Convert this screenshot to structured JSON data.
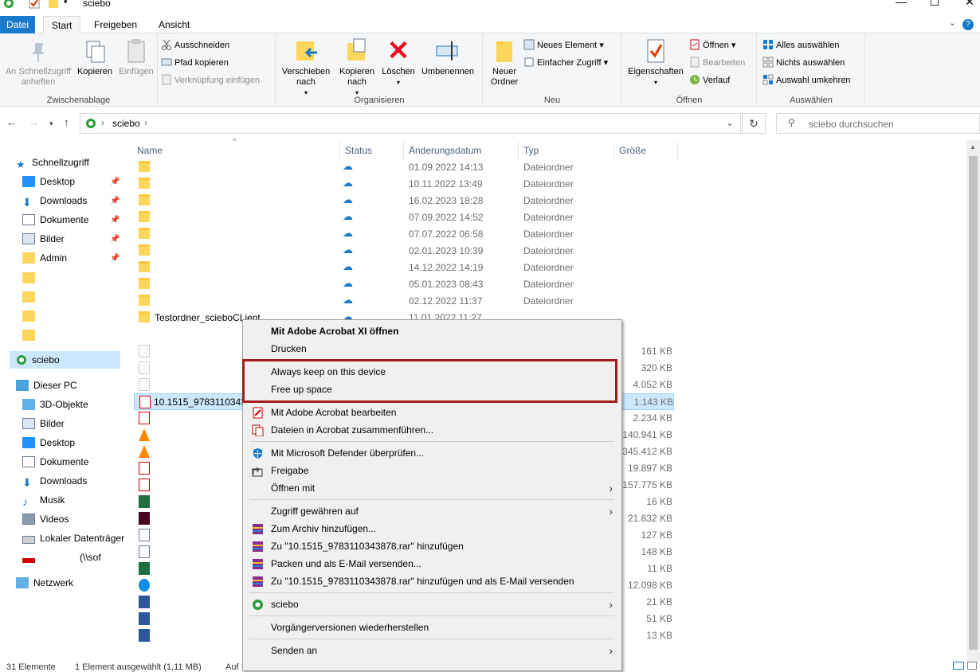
{
  "window": {
    "title": "sciebo",
    "min": "—",
    "max": "☐",
    "close": "✕"
  },
  "ribbon_tabs": [
    "Datei",
    "Start",
    "Freigeben",
    "Ansicht"
  ],
  "ribbon": {
    "clipboard": {
      "label": "Zwischenablage",
      "pin": "An Schnellzugriff anheften",
      "copy": "Kopieren",
      "paste": "Einfügen",
      "cut": "Ausschneiden",
      "copy_path": "Pfad kopieren",
      "paste_link": "Verknüpfung einfügen"
    },
    "organize": {
      "label": "Organisieren",
      "move": "Verschieben nach",
      "copyto": "Kopieren nach",
      "delete": "Löschen",
      "rename": "Umbenennen"
    },
    "new": {
      "label": "Neu",
      "new_folder": "Neuer Ordner",
      "new_item": "Neues Element",
      "easy_access": "Einfacher Zugriff"
    },
    "open": {
      "label": "Öffnen",
      "properties": "Eigenschaften",
      "open": "Öffnen",
      "edit": "Bearbeiten",
      "history": "Verlauf"
    },
    "select": {
      "label": "Auswählen",
      "select_all": "Alles auswählen",
      "select_none": "Nichts auswählen",
      "invert": "Auswahl umkehren"
    }
  },
  "address": {
    "crumb": "sciebo",
    "search_placeholder": "sciebo durchsuchen"
  },
  "nav": {
    "quick_access": "Schnellzugriff",
    "quick_items": [
      "Desktop",
      "Downloads",
      "Dokumente",
      "Bilder",
      "Admin"
    ],
    "sciebo": "sciebo",
    "this_pc": "Dieser PC",
    "pc_items": [
      "3D-Objekte",
      "Bilder",
      "Desktop",
      "Dokumente",
      "Downloads",
      "Musik",
      "Videos",
      "Lokaler Datenträger"
    ],
    "network_drive": "(\\\\sof",
    "network": "Netzwerk"
  },
  "columns": {
    "name": "Name",
    "status": "Status",
    "date": "Änderungsdatum",
    "type": "Typ",
    "size": "Größe"
  },
  "folders": [
    {
      "name": "",
      "date": "01.09.2022 14:13",
      "type": "Dateiordner"
    },
    {
      "name": "",
      "date": "10.11.2022 13:49",
      "type": "Dateiordner"
    },
    {
      "name": "",
      "date": "16.02.2023 18:28",
      "type": "Dateiordner"
    },
    {
      "name": "",
      "date": "07.09.2022 14:52",
      "type": "Dateiordner"
    },
    {
      "name": "",
      "date": "07.07.2022 06:58",
      "type": "Dateiordner"
    },
    {
      "name": "",
      "date": "02.01.2023 10:39",
      "type": "Dateiordner"
    },
    {
      "name": "",
      "date": "14.12.2022 14:19",
      "type": "Dateiordner"
    },
    {
      "name": "",
      "date": "05.01.2023 08:43",
      "type": "Dateiordner"
    },
    {
      "name": "",
      "date": "02.12.2022 11:37",
      "type": "Dateiordner"
    },
    {
      "name": "Testordner_scieboCLient",
      "date": "11.01.2022 11:27",
      "type": ""
    }
  ],
  "sizes": [
    "161 KB",
    "320 KB",
    "4.052 KB",
    "1.143 KB",
    "2.234 KB",
    "140.941 KB",
    "345.412 KB",
    "19.897 KB",
    "157.775 KB",
    "16 KB",
    "21.832 KB",
    "127 KB",
    "148 KB",
    "11 KB",
    "12.098 KB",
    "21 KB",
    "51 KB",
    "13 KB"
  ],
  "selected_file": "10.1515_97831103438",
  "context_menu": {
    "open_acrobat": "Mit Adobe Acrobat XI öffnen",
    "print": "Drucken",
    "keep": "Always keep on this device",
    "free": "Free up space",
    "edit_acrobat": "Mit Adobe Acrobat bearbeiten",
    "merge": "Dateien in Acrobat zusammenführen...",
    "defender": "Mit Microsoft Defender überprüfen...",
    "share": "Freigabe",
    "open_with": "Öffnen mit",
    "grant": "Zugriff gewähren auf",
    "archive": "Zum Archiv hinzufügen...",
    "add_rar": "Zu \"10.1515_9783110343878.rar\" hinzufügen",
    "pack_mail": "Packen und als E-Mail versenden...",
    "rar_mail": "Zu \"10.1515_9783110343878.rar\" hinzufügen und als E-Mail versenden",
    "sciebo": "sciebo",
    "restore": "Vorgängerversionen wiederherstellen",
    "send_to": "Senden an"
  },
  "statusbar": {
    "count": "31 Elemente",
    "selected": "1 Element ausgewählt (1,11 MB)",
    "extra": "Auf"
  },
  "colors": {
    "accent": "#1979ca",
    "highlight_border": "#a31c1c",
    "selection": "#cce8ff",
    "folder": "#ffd65c"
  }
}
